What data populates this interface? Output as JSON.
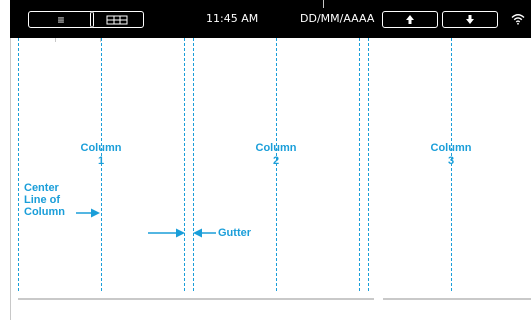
{
  "status_bar": {
    "menu_icon": "hamburger-menu-icon",
    "grid_icon": "grid-layout-icon",
    "time": "11:45 AM",
    "date_format": "DD/MM/AAAA",
    "up_icon": "arrow-up-icon",
    "down_icon": "arrow-down-icon",
    "wifi_icon": "wifi-icon"
  },
  "diagram": {
    "columns": [
      {
        "label": "Column",
        "number": "1"
      },
      {
        "label": "Column",
        "number": "2"
      },
      {
        "label": "Column",
        "number": "3"
      }
    ],
    "center_line_label": [
      "Center",
      "Line of",
      "Column"
    ],
    "gutter_label": "Gutter",
    "accent_color": "#1a9ed9",
    "rule_color": "#c9c9c9"
  }
}
